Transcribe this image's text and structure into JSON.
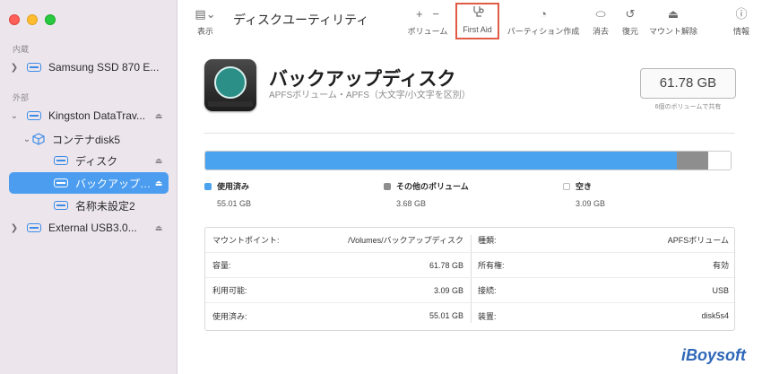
{
  "sidebar": {
    "section_internal": "内蔵",
    "section_external": "外部",
    "items": [
      {
        "label": "Samsung SSD 870 E..."
      },
      {
        "label": "Kingston DataTrav..."
      },
      {
        "label": "コンテナdisk5"
      },
      {
        "label": "ディスク"
      },
      {
        "label": "バックアップ…"
      },
      {
        "label": "名称未設定2"
      },
      {
        "label": "External USB3.0..."
      }
    ]
  },
  "toolbar": {
    "view_label": "表示",
    "title": "ディスクユーティリティ",
    "volume_label": "ボリューム",
    "firstaid_label": "First Aid",
    "partition_label": "パーティション作成",
    "erase_label": "消去",
    "restore_label": "復元",
    "unmount_label": "マウント解除",
    "info_label": "情報",
    "icons": {
      "sidebar_toggle": "sidebar-icon",
      "add": "+",
      "remove": "−",
      "firstaid": "stethoscope-icon",
      "partition": "pie-icon",
      "erase": "erase-icon",
      "restore": "restore-icon",
      "unmount": "eject-icon",
      "info": "info-icon"
    }
  },
  "volume": {
    "name": "バックアップディスク",
    "subtitle": "APFSボリューム・APFS（大文字/小文字を区別）",
    "size": "61.78 GB",
    "shared_note": "6個のボリュームで共有"
  },
  "usage": {
    "used_fraction": 0.897,
    "other_fraction": 0.06,
    "free_fraction": 0.043,
    "colors": {
      "used": "#4aa3ee",
      "other": "#8e8e8e",
      "free": "#ffffff"
    },
    "legend": [
      {
        "name": "使用済み",
        "value": "55.01 GB",
        "color": "#4aa3ee"
      },
      {
        "name": "その他のボリューム",
        "value": "3.68 GB",
        "color": "#8e8e8e"
      },
      {
        "name": "空き",
        "value": "3.09 GB",
        "color": "#ffffff"
      }
    ]
  },
  "info": {
    "left": [
      {
        "key": "マウントポイント:",
        "value": "/Volumes/バックアップディスク"
      },
      {
        "key": "容量:",
        "value": "61.78 GB"
      },
      {
        "key": "利用可能:",
        "value": "3.09 GB"
      },
      {
        "key": "使用済み:",
        "value": "55.01 GB"
      }
    ],
    "right": [
      {
        "key": "種類:",
        "value": "APFSボリューム"
      },
      {
        "key": "所有権:",
        "value": "有効"
      },
      {
        "key": "接続:",
        "value": "USB"
      },
      {
        "key": "装置:",
        "value": "disk5s4"
      }
    ]
  },
  "brand": "iBoysoft"
}
